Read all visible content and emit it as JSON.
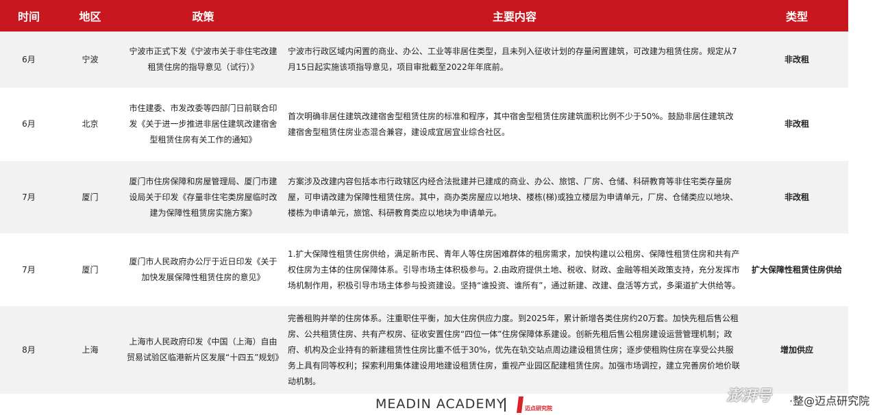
{
  "table": {
    "headers": {
      "time": "时间",
      "region": "地区",
      "policy": "政策",
      "content": "主要内容",
      "type": "类型"
    },
    "rows": [
      {
        "time": "6月",
        "region": "宁波",
        "policy": "宁波市正式下发《宁波市关于非住宅改建租赁住房的指导意见（试行）》",
        "content": "宁波市行政区域内闲置的商业、办公、工业等非居住类型，且未列入征收计划的存量闲置建筑，可改建为租赁住房。规定从7月15日起实施该项指导意见，项目审批截至2022年年底前。",
        "type": "非改租"
      },
      {
        "time": "6月",
        "region": "北京",
        "policy": "市住建委、市发改委等四部门日前联合印发《关于进一步推进非居住建筑改建宿舍型租赁住房有关工作的通知》",
        "content": "首次明确非居住建筑改建宿舍型租赁住房的标准和程序，其中宿舍型租赁住房建筑面积比例不少于50%。鼓励非居住建筑改建宿舍型租赁住房业态混合兼容，建设成宜居宜业综合社区。",
        "type": "非改租"
      },
      {
        "time": "7月",
        "region": "厦门",
        "policy": "厦门市住房保障和房屋管理局、厦门市建设局关于印发《存量非住宅类房屋临时改建为保障性租赁房实施方案》",
        "content": "方案涉及改建内容包括本市行政辖区内经合法批建并已建成的商业、办公、旅馆、厂房、仓储、科研教育等非住宅类存量房屋，可申请改建为保障性租赁住房。其中，商办类房屋应以地块、楼栋(梯)或独立楼层为申请单元，厂房、仓储类应以地块、楼栋为申请单元，旅馆、科研教育类应以地块为申请单元。",
        "type": "非改租"
      },
      {
        "time": "7月",
        "region": "厦门",
        "policy": "厦门市人民政府办公厅于近日印发《关于加快发展保障性租赁住房的意见》",
        "content": "1.扩大保障性租赁住房供给，满足新市民、青年人等住房困难群体的租房需求，加快构建以公租房、保障性租赁住房和共有产权住房为主体的住房保障体系。引导市场主体积极参与。2.由政府提供土地、税收、财政、金融等相关政策支持，充分发挥市场机制作用，积极引导市场主体参与投资建设。坚持“谁投资、谁所有”，通过新建、改建、盘活等方式，多渠道扩大供给等。",
        "type": "扩大保障性租赁住房供给"
      },
      {
        "time": "8月",
        "region": "上海",
        "policy": "上海市人民政府印发《中国（上海）自由贸易试验区临港新片区发展“十四五”规划》",
        "content": "完善租购并举的住房体系。注重职住平衡，加大住房供应力度。到2025年，累计新增各类住房约20万套。加快先租后售公租房、公共租赁住房、共有产权房、征收安置住房“四位一体”住房保障体系建设。创新先租后售公租房建设运营管理机制；政府、机构及企业持有的新建租赁性住房比重不低于30%，优先在轨交站点周边建设租赁住房；逐步使租购住房在享受公共服务上具有同等权利；探索利用集体建设用地建设租赁住房，重视产业园区配建租赁住房。加强市场调控，建立完善房价地价联动机制。",
        "type": "增加供应"
      }
    ]
  },
  "footer": {
    "brand": "MEADIN ACADEMY",
    "logo_text": "迈点研究院",
    "watermark": "澎湃号",
    "corner_text": "·整@迈点研究院"
  },
  "colors": {
    "header_bg": "#c8171e",
    "stripe_bg": "#f2f2f2",
    "logo_red": "#d9232a"
  }
}
